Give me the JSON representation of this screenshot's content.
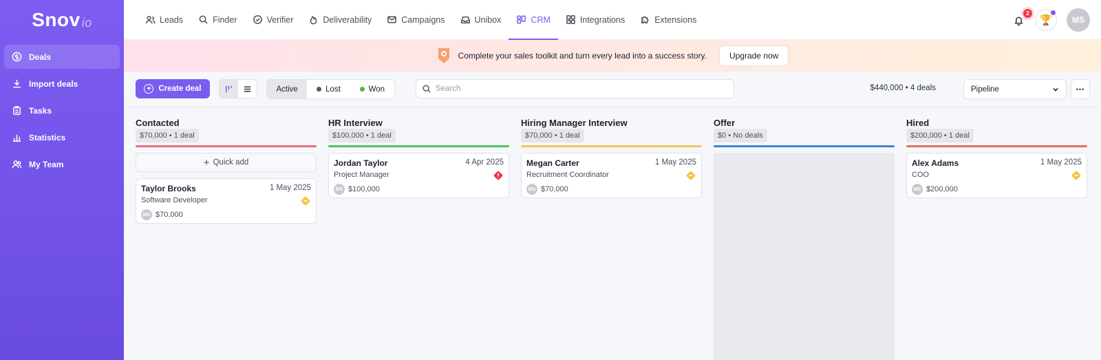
{
  "app": {
    "logo_main": "Snov",
    "logo_suffix": "io"
  },
  "sidebar": {
    "items": [
      {
        "label": "Deals",
        "icon": "dollar-icon",
        "active": true
      },
      {
        "label": "Import deals",
        "icon": "download-icon",
        "active": false
      },
      {
        "label": "Tasks",
        "icon": "clipboard-icon",
        "active": false
      },
      {
        "label": "Statistics",
        "icon": "bar-chart-icon",
        "active": false
      },
      {
        "label": "My Team",
        "icon": "team-icon",
        "active": false
      }
    ]
  },
  "topnav": {
    "tabs": [
      {
        "label": "Leads",
        "icon": "users-icon"
      },
      {
        "label": "Finder",
        "icon": "search-icon"
      },
      {
        "label": "Verifier",
        "icon": "check-circle-icon"
      },
      {
        "label": "Deliverability",
        "icon": "flame-icon"
      },
      {
        "label": "Campaigns",
        "icon": "mail-icon"
      },
      {
        "label": "Unibox",
        "icon": "inbox-icon"
      },
      {
        "label": "CRM",
        "icon": "crm-icon",
        "active": true
      },
      {
        "label": "Integrations",
        "icon": "grid-icon"
      },
      {
        "label": "Extensions",
        "icon": "puzzle-icon"
      }
    ],
    "notification_count": "2",
    "avatar_initials": "MS"
  },
  "banner": {
    "text": "Complete your sales toolkit and turn every lead into a success story.",
    "button": "Upgrade now"
  },
  "toolbar": {
    "create_label": "Create deal",
    "filters": {
      "active": "Active",
      "lost": "Lost",
      "won": "Won"
    },
    "search_placeholder": "Search",
    "summary": "$440,000 • 4 deals",
    "pipeline": "Pipeline",
    "more": "•••"
  },
  "colors": {
    "accent": "#7b5cf0",
    "lost_dot": "#55565f",
    "won_dot": "#4cbb3a",
    "contacted": "#ef6b7a",
    "hr_interview": "#4cc45a",
    "hiring_manager": "#f2c55c",
    "offer": "#3b82d6",
    "hired": "#ef6b56"
  },
  "board": {
    "quick_add": "Quick add",
    "columns": [
      {
        "title": "Contacted",
        "summary": "$70,000 • 1 deal",
        "cards": [
          {
            "name": "Taylor Brooks",
            "date": "1 May 2025",
            "role": "Software Developer",
            "owner": "MS",
            "amount": "$70,000",
            "priority": "medium"
          }
        ]
      },
      {
        "title": "HR Interview",
        "summary": "$100,000 • 1 deal",
        "cards": [
          {
            "name": "Jordan Taylor",
            "date": "4 Apr 2025",
            "role": "Project Manager",
            "owner": "MS",
            "amount": "$100,000",
            "priority": "high"
          }
        ]
      },
      {
        "title": "Hiring Manager Interview",
        "summary": "$70,000 • 1 deal",
        "cards": [
          {
            "name": "Megan Carter",
            "date": "1 May 2025",
            "role": "Recruitment Coordinator",
            "owner": "MS",
            "amount": "$70,000",
            "priority": "medium"
          }
        ]
      },
      {
        "title": "Offer",
        "summary": "$0 • No deals",
        "cards": []
      },
      {
        "title": "Hired",
        "summary": "$200,000 • 1 deal",
        "cards": [
          {
            "name": "Alex Adams",
            "date": "1 May 2025",
            "role": "COO",
            "owner": "MS",
            "amount": "$200,000",
            "priority": "medium"
          }
        ]
      }
    ]
  }
}
